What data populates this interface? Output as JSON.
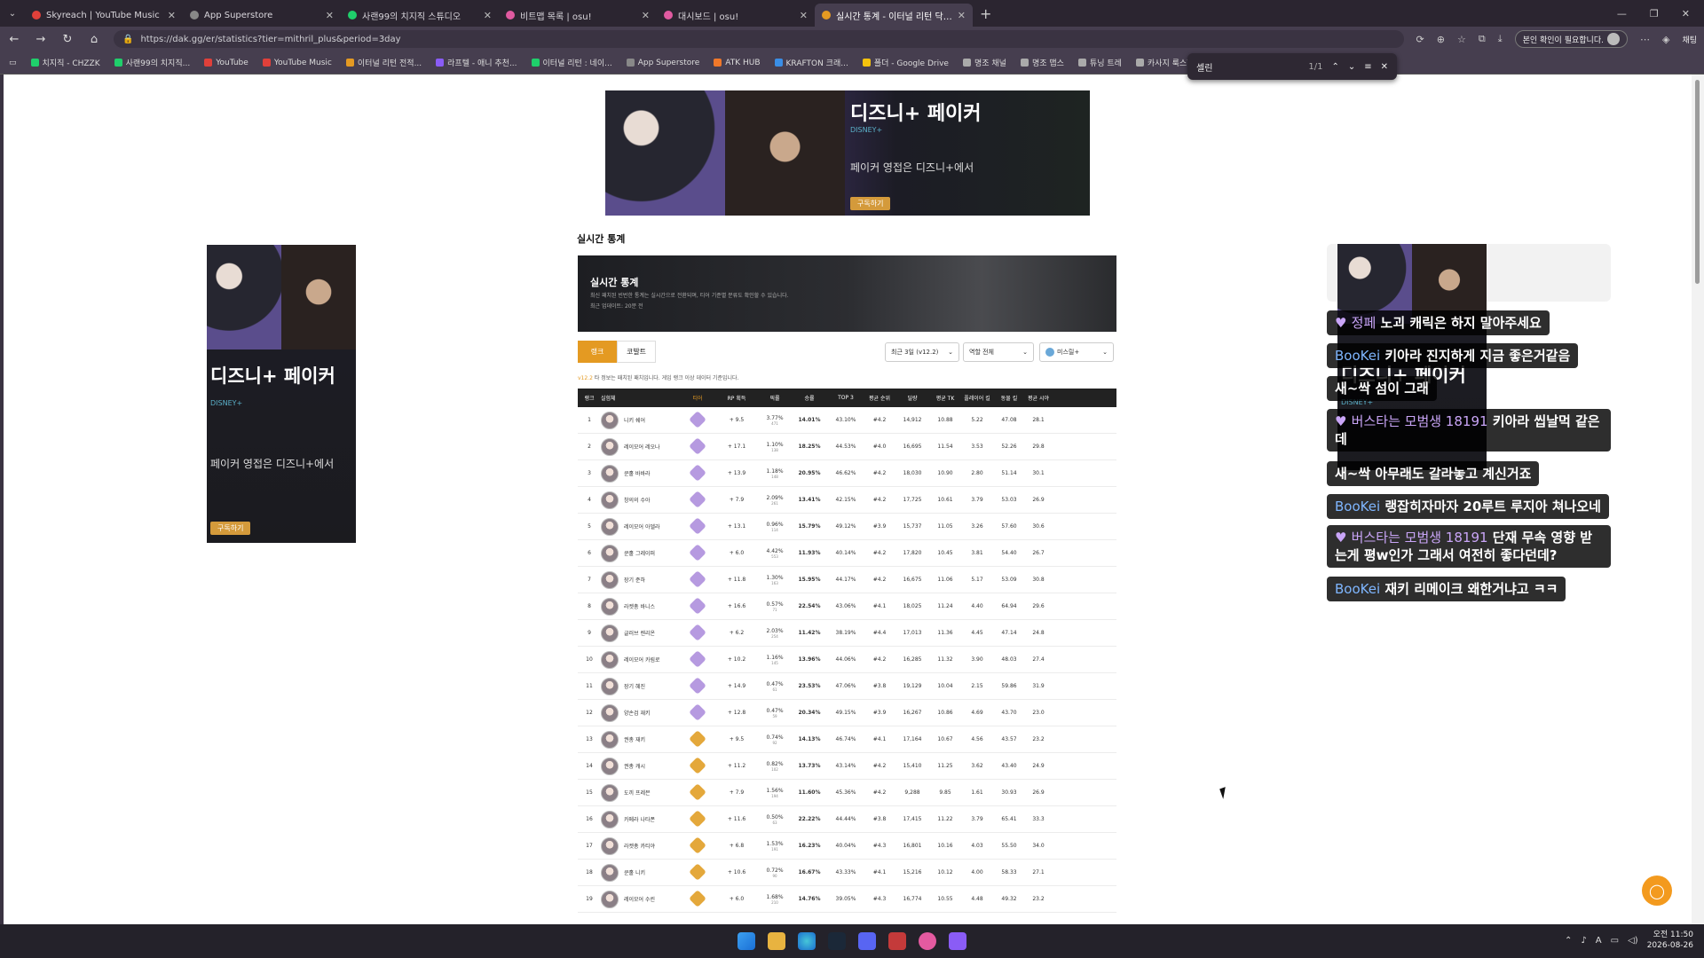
{
  "tabs": [
    {
      "title": "Skyreach | YouTube Music",
      "color": "#e0403a"
    },
    {
      "title": "App Superstore",
      "color": "#888888"
    },
    {
      "title": "사랜99의 치지직 스튜디오",
      "color": "#1fcf6b"
    },
    {
      "title": "비트맵 목록 | osu!",
      "color": "#e05aa0"
    },
    {
      "title": "대시보드 | osu!",
      "color": "#e05aa0"
    },
    {
      "title": "실시간 통계 - 이터널 리턴 닥지지",
      "color": "#e49a22"
    }
  ],
  "url": "https://dak.gg/er/statistics?tier=mithril_plus&period=3day",
  "profile_label": "본인 확인이 필요합니다.",
  "chat_label": "채팅",
  "bookmarks": [
    {
      "label": "치지직 - CHZZK",
      "color": "#1fcf6b"
    },
    {
      "label": "사랜99의 치지직...",
      "color": "#1fcf6b"
    },
    {
      "label": "YouTube",
      "color": "#e0403a"
    },
    {
      "label": "YouTube Music",
      "color": "#e0403a"
    },
    {
      "label": "이터널 리턴 전적...",
      "color": "#e49a22"
    },
    {
      "label": "라프텔 - 애니 추천...",
      "color": "#8a5cf6"
    },
    {
      "label": "이터널 리턴 : 네이...",
      "color": "#1fcf6b"
    },
    {
      "label": "App Superstore",
      "color": "#888888"
    },
    {
      "label": "ATK HUB",
      "color": "#f0782a"
    },
    {
      "label": "KRAFTON 크래...",
      "color": "#3a8ee6"
    },
    {
      "label": "폴더 - Google Drive",
      "color": "#f4c20d"
    },
    {
      "label": "명조 채널",
      "color": "#aaaaaa"
    },
    {
      "label": "명조 맵스",
      "color": "#aaaaaa"
    },
    {
      "label": "튜닝 트레",
      "color": "#aaaaaa"
    },
    {
      "label": "카사지 룩스한의...",
      "color": "#aaaaaa"
    }
  ],
  "find": {
    "query": "셀린",
    "count": "1/1"
  },
  "ad": {
    "title": "디즈니+ 페이커",
    "brand": "DISNEY+",
    "text": "페이커 영접은 디즈니+에서",
    "button": "구독하기"
  },
  "page": {
    "section_title": "실시간 통계",
    "banner_title": "실시간 통계",
    "banner_desc_1": "최신 패치된 빈번한 통계는 실시간으로 전환되며, 티어 기준별 분류도 확인할 수 있습니다.",
    "banner_desc_2": "최근 업데이트: 20분 전",
    "tab_rank": "랭크",
    "tab_cobalt": "코발트",
    "filter_period": "최근 3일 (v12.2)",
    "filter_weapon": "역할 전체",
    "filter_tier": "미스릴+",
    "note_badge": "v12.2",
    "note_text": "타 정보는 패치된 패치입니다. 게임 랭크 이상 데이터 기준입니다."
  },
  "table": {
    "headers": [
      "랭크",
      "실험체",
      "티어",
      "RP 획득",
      "픽률",
      "승률",
      "TOP 3",
      "평균 순위",
      "딜량",
      "평균 TK",
      "플레이어 킬",
      "동물 킬",
      "평균 시야"
    ],
    "rows": [
      {
        "rank": "1",
        "name": "니키 쉐어",
        "tier": "S",
        "rp": "+ 9.5",
        "pick": "3.77%",
        "pick_sub": "471",
        "win": "14.01%",
        "top3": "43.10%",
        "avg": "#4.2",
        "dmg": "14,912",
        "tk": "10.88",
        "pk": "5.22",
        "ak": "47.08",
        "vis": "28.1"
      },
      {
        "rank": "2",
        "name": "레이모어 레오나",
        "tier": "S",
        "rp": "+ 17.1",
        "pick": "1.10%",
        "pick_sub": "138",
        "win": "18.25%",
        "top3": "44.53%",
        "avg": "#4.0",
        "dmg": "16,695",
        "tk": "11.54",
        "pk": "3.53",
        "ak": "52.26",
        "vis": "29.8"
      },
      {
        "rank": "3",
        "name": "쿤홀 바바라",
        "tier": "S",
        "rp": "+ 13.9",
        "pick": "1.18%",
        "pick_sub": "148",
        "win": "20.95%",
        "top3": "46.62%",
        "avg": "#4.2",
        "dmg": "18,030",
        "tk": "10.90",
        "pk": "2.80",
        "ak": "51.14",
        "vis": "30.1"
      },
      {
        "rank": "4",
        "name": "창의의 수아",
        "tier": "S",
        "rp": "+ 7.9",
        "pick": "2.09%",
        "pick_sub": "261",
        "win": "13.41%",
        "top3": "42.15%",
        "avg": "#4.2",
        "dmg": "17,725",
        "tk": "10.61",
        "pk": "3.79",
        "ak": "53.03",
        "vis": "26.9"
      },
      {
        "rank": "5",
        "name": "레이모어 아델라",
        "tier": "S",
        "rp": "+ 13.1",
        "pick": "0.96%",
        "pick_sub": "114",
        "win": "15.79%",
        "top3": "49.12%",
        "avg": "#3.9",
        "dmg": "15,737",
        "tk": "11.05",
        "pk": "3.26",
        "ak": "57.60",
        "vis": "30.6"
      },
      {
        "rank": "6",
        "name": "쿤홀 그레이퍼",
        "tier": "S",
        "rp": "+ 6.0",
        "pick": "4.42%",
        "pick_sub": "553",
        "win": "11.93%",
        "top3": "40.14%",
        "avg": "#4.2",
        "dmg": "17,820",
        "tk": "10.45",
        "pk": "3.81",
        "ak": "54.40",
        "vis": "26.7"
      },
      {
        "rank": "7",
        "name": "장기 준하",
        "tier": "S",
        "rp": "+ 11.8",
        "pick": "1.30%",
        "pick_sub": "163",
        "win": "15.95%",
        "top3": "44.17%",
        "avg": "#4.2",
        "dmg": "16,675",
        "tk": "11.06",
        "pk": "5.17",
        "ak": "53.09",
        "vis": "30.8"
      },
      {
        "rank": "8",
        "name": "라켓총 바니스",
        "tier": "S",
        "rp": "+ 16.6",
        "pick": "0.57%",
        "pick_sub": "71",
        "win": "22.54%",
        "top3": "43.06%",
        "avg": "#4.1",
        "dmg": "18,025",
        "tk": "11.24",
        "pk": "4.40",
        "ak": "64.94",
        "vis": "29.6"
      },
      {
        "rank": "9",
        "name": "글러브 렌리온",
        "tier": "S",
        "rp": "+ 6.2",
        "pick": "2.03%",
        "pick_sub": "254",
        "win": "11.42%",
        "top3": "38.19%",
        "avg": "#4.4",
        "dmg": "17,013",
        "tk": "11.36",
        "pk": "4.45",
        "ak": "47.14",
        "vis": "24.8"
      },
      {
        "rank": "10",
        "name": "레이모어 카림로",
        "tier": "S",
        "rp": "+ 10.2",
        "pick": "1.16%",
        "pick_sub": "145",
        "win": "13.96%",
        "top3": "44.06%",
        "avg": "#4.2",
        "dmg": "16,285",
        "tk": "11.32",
        "pk": "3.90",
        "ak": "48.03",
        "vis": "27.4"
      },
      {
        "rank": "11",
        "name": "장기 혜진",
        "tier": "S",
        "rp": "+ 14.9",
        "pick": "0.47%",
        "pick_sub": "61",
        "win": "23.53%",
        "top3": "47.06%",
        "avg": "#3.8",
        "dmg": "19,129",
        "tk": "10.04",
        "pk": "2.15",
        "ak": "59.86",
        "vis": "31.9"
      },
      {
        "rank": "12",
        "name": "양손검 재키",
        "tier": "S",
        "rp": "+ 12.8",
        "pick": "0.47%",
        "pick_sub": "59",
        "win": "20.34%",
        "top3": "49.15%",
        "avg": "#3.9",
        "dmg": "16,267",
        "tk": "10.86",
        "pk": "4.69",
        "ak": "43.70",
        "vis": "23.0"
      },
      {
        "rank": "13",
        "name": "권총 재키",
        "tier": "A",
        "rp": "+ 9.5",
        "pick": "0.74%",
        "pick_sub": "92",
        "win": "14.13%",
        "top3": "46.74%",
        "avg": "#4.1",
        "dmg": "17,164",
        "tk": "10.67",
        "pk": "4.56",
        "ak": "43.57",
        "vis": "23.2"
      },
      {
        "rank": "14",
        "name": "권총 캐시",
        "tier": "A",
        "rp": "+ 11.2",
        "pick": "0.82%",
        "pick_sub": "102",
        "win": "13.73%",
        "top3": "43.14%",
        "avg": "#4.2",
        "dmg": "15,410",
        "tk": "11.25",
        "pk": "3.62",
        "ak": "43.40",
        "vis": "24.9"
      },
      {
        "rank": "15",
        "name": "도끼 프레븐",
        "tier": "A",
        "rp": "+ 7.9",
        "pick": "1.56%",
        "pick_sub": "194",
        "win": "11.60%",
        "top3": "45.36%",
        "avg": "#4.2",
        "dmg": "9,288",
        "tk": "9.85",
        "pk": "1.61",
        "ak": "30.93",
        "vis": "26.9"
      },
      {
        "rank": "16",
        "name": "카메라 나타폰",
        "tier": "A",
        "rp": "+ 11.6",
        "pick": "0.50%",
        "pick_sub": "63",
        "win": "22.22%",
        "top3": "44.44%",
        "avg": "#3.8",
        "dmg": "17,415",
        "tk": "11.22",
        "pk": "3.79",
        "ak": "65.41",
        "vis": "33.3"
      },
      {
        "rank": "17",
        "name": "라켓총 카티야",
        "tier": "A",
        "rp": "+ 6.8",
        "pick": "1.53%",
        "pick_sub": "191",
        "win": "16.23%",
        "top3": "40.04%",
        "avg": "#4.3",
        "dmg": "16,801",
        "tk": "10.16",
        "pk": "4.03",
        "ak": "55.50",
        "vis": "34.0"
      },
      {
        "rank": "18",
        "name": "쿤홀 니키",
        "tier": "A",
        "rp": "+ 10.6",
        "pick": "0.72%",
        "pick_sub": "90",
        "win": "16.67%",
        "top3": "43.33%",
        "avg": "#4.1",
        "dmg": "15,216",
        "tk": "10.12",
        "pk": "4.00",
        "ak": "58.33",
        "vis": "27.1"
      },
      {
        "rank": "19",
        "name": "레이모어 수린",
        "tier": "A",
        "rp": "+ 6.0",
        "pick": "1.68%",
        "pick_sub": "210",
        "win": "14.76%",
        "top3": "39.05%",
        "avg": "#4.3",
        "dmg": "16,774",
        "tk": "10.55",
        "pk": "4.48",
        "ak": "49.32",
        "vis": "23.2"
      }
    ]
  },
  "chat": [
    {
      "user": "정페",
      "text": "노괴 캐릭은 하지 말아주세요",
      "badge": true
    },
    {
      "user": "BooKei",
      "text": "키아라 진지하게 지금 좋은거같음",
      "badge": false
    },
    {
      "user": "",
      "text": "새~싹 섬이 그래",
      "badge": false
    },
    {
      "user": "버스타는 모범생 18191",
      "text": "키아라 씹날먹 같은데",
      "badge": true
    },
    {
      "user": "",
      "text": "새~싹 아무래도 갈라놓고 계신거죠",
      "badge": false
    },
    {
      "user": "BooKei",
      "text": "랭잡히자마자 20루트 루지아 쳐나오네",
      "badge": false
    },
    {
      "user": "버스타는 모범생 18191",
      "text": "단재 무속 영향 받는게 평w인가 그래서 여전히 좋다던데?",
      "badge": true
    },
    {
      "user": "BooKei",
      "text": "재키 리메이크 왜한거냐고 ㅋㅋ",
      "badge": false
    }
  ],
  "clock": {
    "time": "오전 11:50",
    "date": "2026-08-26"
  },
  "colors": {
    "accent": "#e49a22",
    "tier_s": "#b69ae0",
    "tier_a": "#e4a83b"
  }
}
